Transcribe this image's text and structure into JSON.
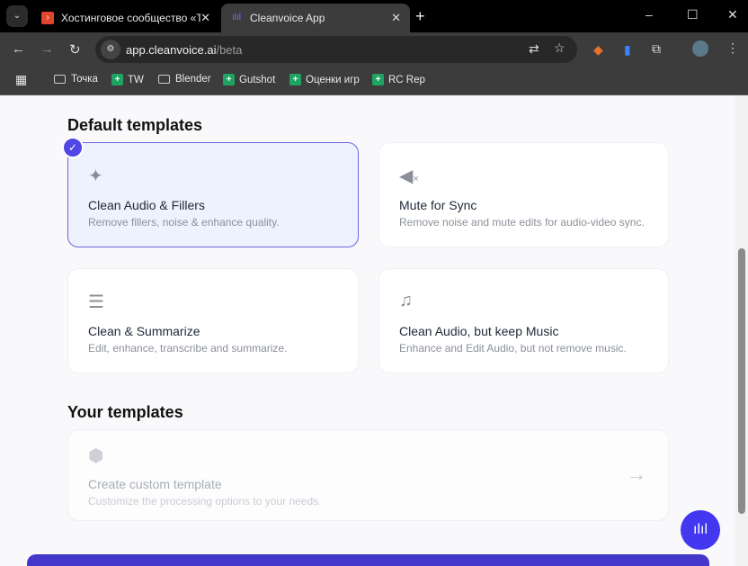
{
  "browser": {
    "tabs": [
      {
        "title": "Хостинговое сообщество «Tim",
        "active": false
      },
      {
        "title": "Cleanvoice App",
        "active": true
      }
    ],
    "url_host": "app.cleanvoice.ai",
    "url_path": "/beta",
    "bookmarks": [
      {
        "label": "Точка",
        "type": "folder"
      },
      {
        "label": "TW",
        "type": "sheet"
      },
      {
        "label": "Blender",
        "type": "folder"
      },
      {
        "label": "Gutshot",
        "type": "sheet"
      },
      {
        "label": "Оценки игр",
        "type": "sheet"
      },
      {
        "label": "RC Rep",
        "type": "sheet"
      }
    ]
  },
  "default_templates": {
    "heading": "Default templates",
    "items": [
      {
        "title": "Clean Audio & Fillers",
        "desc": "Remove fillers, noise & enhance quality.",
        "icon": "sparkles-icon",
        "selected": true
      },
      {
        "title": "Mute for Sync",
        "desc": "Remove noise and mute edits for audio-video sync.",
        "icon": "speaker-mute-icon",
        "selected": false
      },
      {
        "title": "Clean & Summarize",
        "desc": "Edit, enhance, transcribe and summarize.",
        "icon": "list-icon",
        "selected": false
      },
      {
        "title": "Clean Audio, but keep Music",
        "desc": "Enhance and Edit Audio, but not remove music.",
        "icon": "music-note-icon",
        "selected": false
      }
    ]
  },
  "your_templates": {
    "heading": "Your templates",
    "create": {
      "title": "Create custom template",
      "desc": "Customize the processing options to your needs."
    }
  },
  "colors": {
    "accent": "#4f46e5",
    "bar": "#4338ca"
  }
}
